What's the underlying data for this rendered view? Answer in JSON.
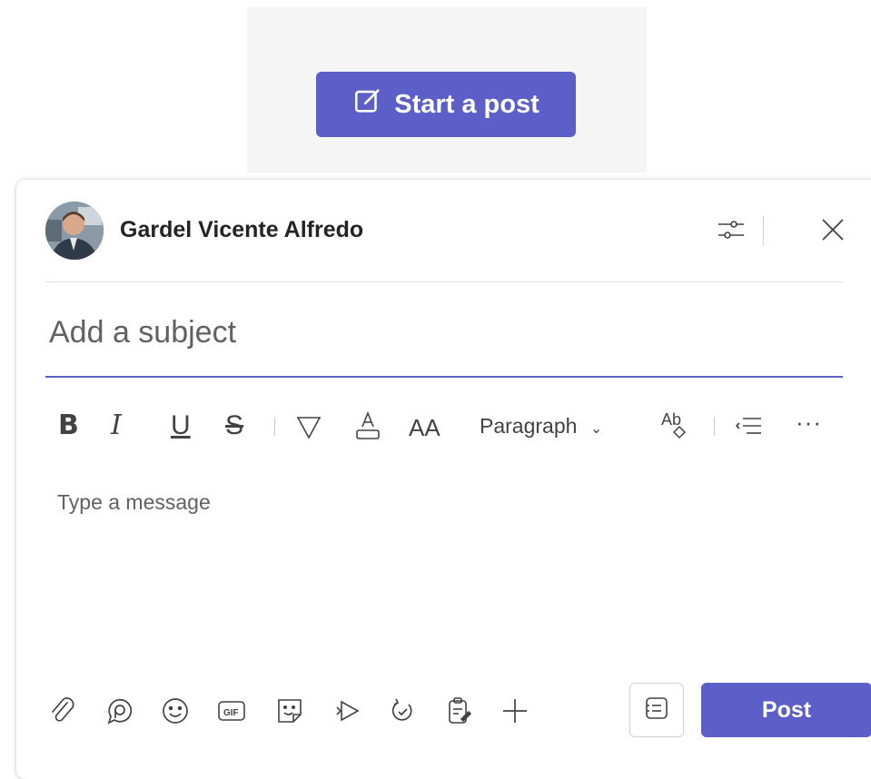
{
  "top": {
    "start_post_label": "Start a post"
  },
  "composer": {
    "author_name": "Gardel Vicente Alfredo",
    "subject_placeholder": "Add a subject",
    "message_placeholder": "Type a message",
    "format": {
      "bold": "B",
      "italic": "I",
      "underline": "U",
      "strike": "S",
      "font_size": "AA",
      "paragraph": "Paragraph",
      "more": "···"
    },
    "post_label": "Post"
  },
  "colors": {
    "accent": "#5b5fc7",
    "strip_bg": "#f5f5f5",
    "text": "#242424",
    "muted": "#616161"
  },
  "icons": [
    "compose-icon",
    "options-icon",
    "close-icon",
    "highlight-icon",
    "font-color-icon",
    "clear-format-icon",
    "bullets-icon",
    "attach-icon",
    "loop-icon",
    "emoji-icon",
    "gif-icon",
    "sticker-icon",
    "stream-icon",
    "praise-icon",
    "approvals-icon",
    "plus-icon",
    "format-icon"
  ]
}
